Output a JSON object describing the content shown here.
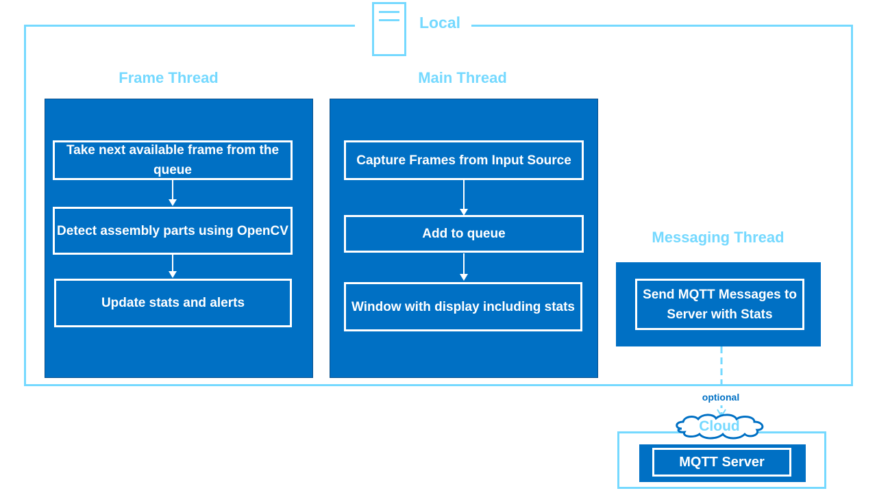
{
  "local": {
    "title": "Local",
    "icon": "server-icon"
  },
  "frame_thread": {
    "label": "Frame Thread",
    "steps": [
      "Take next available frame from the queue",
      "Detect assembly parts using OpenCV",
      "Update stats and alerts"
    ]
  },
  "main_thread": {
    "label": "Main Thread",
    "steps": [
      "Capture Frames from Input Source",
      "Add to queue",
      "Window with display including stats"
    ]
  },
  "messaging_thread": {
    "label": "Messaging Thread",
    "steps": [
      "Send MQTT Messages to Server with Stats"
    ]
  },
  "connector": {
    "label": "optional"
  },
  "cloud": {
    "title": "Cloud",
    "server": "MQTT Server"
  },
  "colors": {
    "accent": "#75d9ff",
    "box": "#0070c4",
    "text": "#ffffff"
  }
}
